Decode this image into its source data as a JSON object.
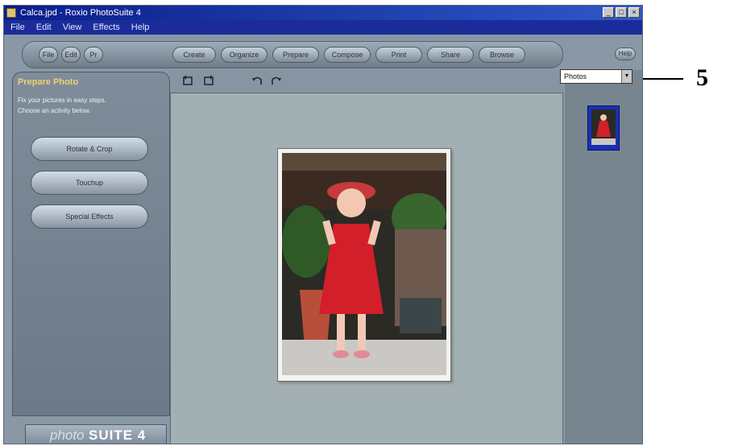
{
  "window": {
    "title": "Calca.jpd - Roxio PhotoSuite 4",
    "buttons": {
      "minimize": "_",
      "maximize": "□",
      "close": "×"
    }
  },
  "menu": [
    "File",
    "Edit",
    "View",
    "Effects",
    "Help"
  ],
  "top_tabs": [
    "File",
    "Edit",
    "Pr",
    "Create",
    "Organize",
    "Prepare",
    "Compose",
    "Print",
    "Share",
    "Browse"
  ],
  "corner_button": "Help",
  "left_panel": {
    "title": "Prepare Photo",
    "desc_line1": "Fix your pictures in easy steps.",
    "desc_line2": "Choose an activity below.",
    "actions": [
      "Rotate & Crop",
      "Touchup",
      "Special Effects"
    ]
  },
  "brand": {
    "part1": "photo",
    "part2": "SUITE 4"
  },
  "dropdown": {
    "value": "Photos"
  },
  "callout": {
    "number": "5"
  },
  "colors": {
    "title_bar": "#0a1e8c",
    "panel": "#7f8d9b",
    "canvas": "#a3b0b3",
    "dress": "#d21f2a"
  }
}
